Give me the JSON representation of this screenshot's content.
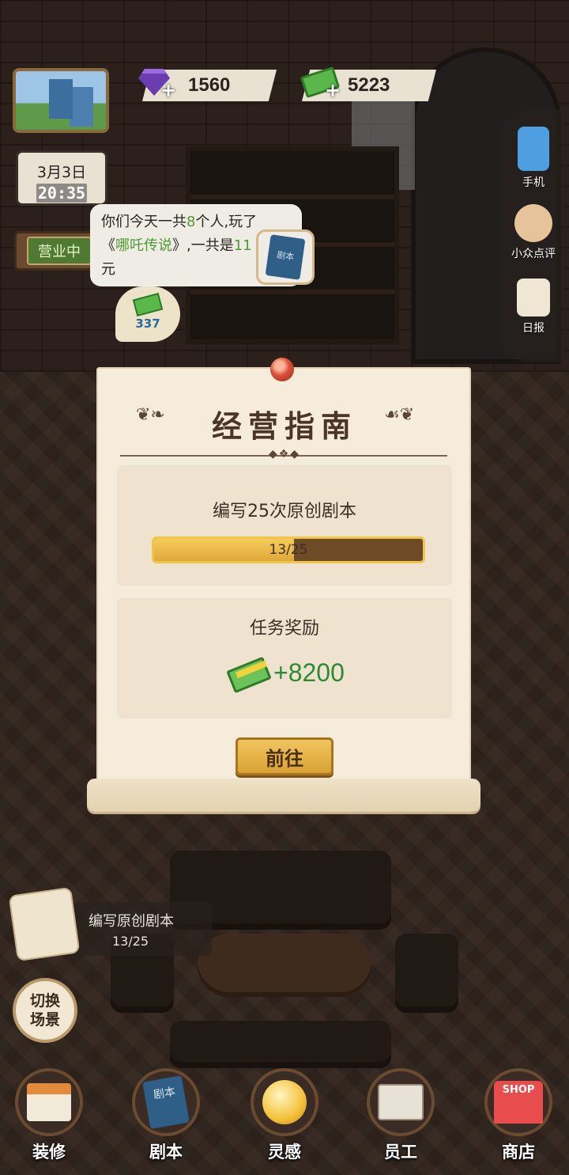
{
  "resources": {
    "gems": "1560",
    "cash": "5223",
    "plus": "+"
  },
  "clock": {
    "date": "3月3日",
    "time": "20:35"
  },
  "status_sign": "营业中",
  "speech": {
    "line1_a": "你们今天一共",
    "line1_count": "8",
    "line1_b": "个人,玩了",
    "line2_a": "《",
    "line2_title": "哪吒传说",
    "line2_b": "》,一共是",
    "line2_amount": "11",
    "line3": "元"
  },
  "script_badge_text": "剧本",
  "cash_bubble": "337",
  "side_buttons": [
    {
      "label": "手机",
      "icon": "phone-icon"
    },
    {
      "label": "小众点评",
      "icon": "thumbs-up-icon"
    },
    {
      "label": "日报",
      "icon": "clipboard-icon"
    }
  ],
  "dialog": {
    "title": "经营指南",
    "task": "编写25次原创剧本",
    "progress_text": "13/25",
    "progress_current": 13,
    "progress_total": 25,
    "reward_title": "任务奖励",
    "reward_amount": "+8200",
    "go_button": "前往"
  },
  "task_tracker": {
    "title": "编写原创剧本",
    "progress": "13/25"
  },
  "switch_scene": "切换场景",
  "bottom_nav": [
    {
      "label": "装修",
      "icon": "house-icon"
    },
    {
      "label": "剧本",
      "icon": "script-book-icon"
    },
    {
      "label": "灵感",
      "icon": "lightbulb-icon"
    },
    {
      "label": "员工",
      "icon": "staff-badge-icon"
    },
    {
      "label": "商店",
      "icon": "shop-icon"
    }
  ],
  "nav_icon_text": {
    "script": "剧本",
    "shop": "SHOP"
  },
  "colors": {
    "reward_green": "#2e8a35",
    "progress_gold": "#f0c54a",
    "dialog_bg": "#f6ecdc",
    "highlight_green": "#4d9a2d"
  }
}
